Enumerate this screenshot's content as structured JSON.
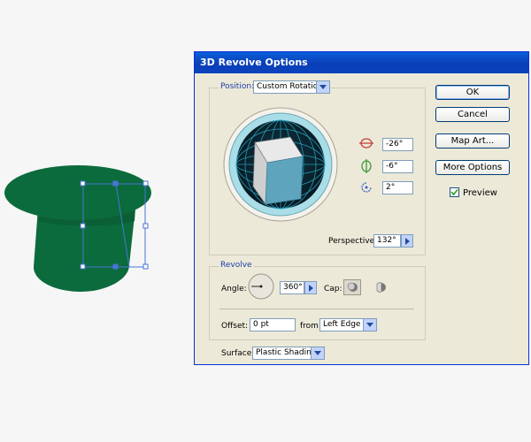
{
  "dialog": {
    "title": "3D Revolve Options",
    "position": {
      "label": "Position:",
      "selected": "Custom Rotation",
      "x_rotation": "-26°",
      "y_rotation": "-6°",
      "z_rotation": "2°",
      "perspective_label": "Perspective:",
      "perspective_value": "132°"
    },
    "revolve": {
      "title": "Revolve",
      "angle_label": "Angle:",
      "angle_value": "360°",
      "cap_label": "Cap:",
      "offset_label": "Offset:",
      "offset_value": "0 pt",
      "from_label": "from",
      "from_selected": "Left Edge"
    },
    "surface": {
      "label": "Surface:",
      "selected": "Plastic Shading"
    },
    "buttons": {
      "ok": "OK",
      "cancel": "Cancel",
      "map_art": "Map Art...",
      "more_options": "More Options"
    },
    "preview": {
      "label": "Preview",
      "checked": true
    }
  },
  "colors": {
    "hat": "#0b6b3c",
    "cube_front": "#5fa4bd",
    "selection": "#4a74d8"
  }
}
